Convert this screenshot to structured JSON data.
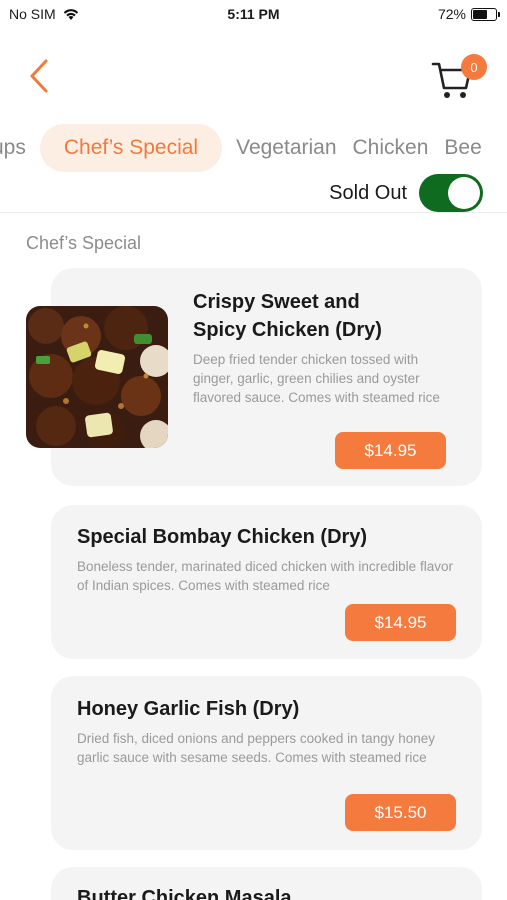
{
  "status_bar": {
    "carrier": "No SIM",
    "time": "5:11 PM",
    "battery": "72%",
    "battery_level": 0.72
  },
  "header": {
    "back_icon": "chevron-left-icon",
    "cart_icon": "cart-icon",
    "cart_count": "0"
  },
  "tabs": [
    {
      "label": "Soups",
      "visible_text": "ups",
      "active": false
    },
    {
      "label": "Chef’s Special",
      "visible_text": "Chef’s Special",
      "active": true
    },
    {
      "label": "Vegetarian",
      "visible_text": "Vegetarian",
      "active": false
    },
    {
      "label": "Chicken",
      "visible_text": "Chicken",
      "active": false
    },
    {
      "label": "Beef",
      "visible_text": "Bee",
      "active": false
    }
  ],
  "sold_out": {
    "label": "Sold Out",
    "enabled": true
  },
  "section_title": "Chef’s Special",
  "items": [
    {
      "title_line1": "Crispy Sweet and",
      "title_line2": "Spicy Chicken (Dry)",
      "description": "Deep fried tender chicken tossed with ginger, garlic, green chilies and oyster flavored sauce. Comes with steamed rice",
      "price": "$14.95"
    },
    {
      "title": "Special Bombay Chicken (Dry)",
      "description": "Boneless tender, marinated diced chicken with incredible flavor of Indian spices. Comes with steamed rice",
      "price": "$14.95"
    },
    {
      "title": "Honey Garlic Fish (Dry)",
      "description": "Dried fish, diced onions and peppers cooked in tangy honey garlic sauce with sesame seeds. Comes with steamed rice",
      "price": "$15.50"
    },
    {
      "title": "Butter Chicken Masala"
    }
  ],
  "colors": {
    "accent": "#f47a3d",
    "tab_active_bg": "#fdeee4",
    "toggle_on": "#0f6b1f",
    "card_bg": "#f4f4f4"
  }
}
